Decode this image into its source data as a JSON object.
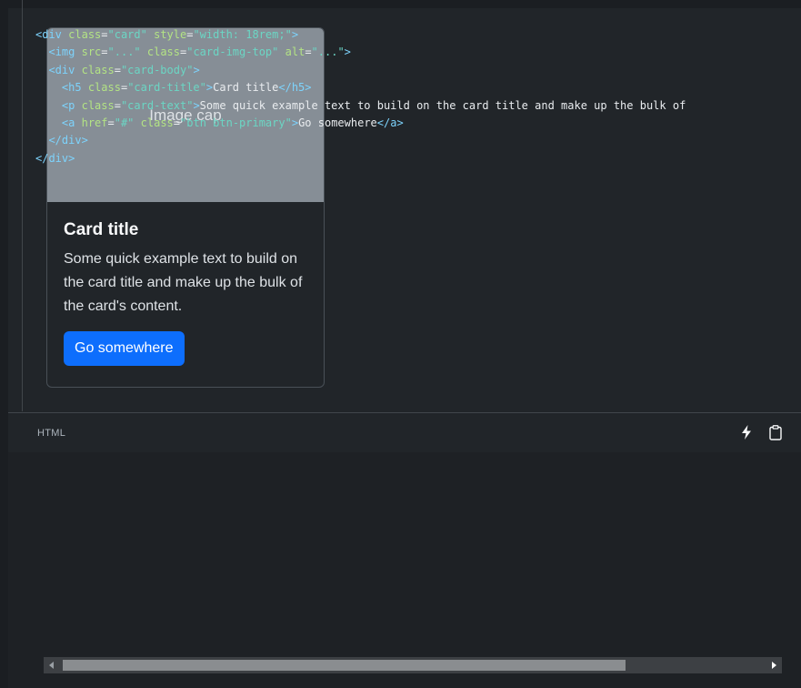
{
  "card": {
    "image_text": "Image cap",
    "title": "Card title",
    "text": "Some quick example text to build on the card title and make up the bulk of the card's content.",
    "button_label": "Go somewhere"
  },
  "code_block": {
    "language": "HTML",
    "icons": [
      "lightning-icon",
      "clipboard-icon"
    ]
  },
  "code_text": {
    "l1_tag_open": "<div",
    "l1_attr1": "class",
    "l1_val1": "\"card\"",
    "l1_attr2": "style",
    "l1_val2": "\"width: 18rem;\"",
    "l1_close": ">",
    "l2_tag": "<img",
    "l2_attr1": "src",
    "l2_val1": "\"...\"",
    "l2_attr2": "class",
    "l2_val2": "\"card-img-top\"",
    "l2_attr3": "alt",
    "l2_val3": "\"...\"",
    "l2_close": ">",
    "l3_tag": "<div",
    "l3_attr": "class",
    "l3_val": "\"card-body\"",
    "l3_close": ">",
    "l4_tag": "<h5",
    "l4_attr": "class",
    "l4_val": "\"card-title\"",
    "l4_gt": ">",
    "l4_text": "Card title",
    "l4_end": "</h5>",
    "l5_tag": "<p",
    "l5_attr": "class",
    "l5_val": "\"card-text\"",
    "l5_gt": ">",
    "l5_text": "Some quick example text to build on the card title and make up the bulk of",
    "l6_tag": "<a",
    "l6_attr1": "href",
    "l6_val1": "\"#\"",
    "l6_attr2": "class",
    "l6_val2": "\"btn btn-primary\"",
    "l6_gt": ">",
    "l6_text": "Go somewhere",
    "l6_end": "</a>",
    "l7_end": "</div>",
    "l8_end": "</div>"
  },
  "colors": {
    "background": "#212529",
    "primary": "#0d6efd",
    "image_placeholder": "#868e96"
  }
}
